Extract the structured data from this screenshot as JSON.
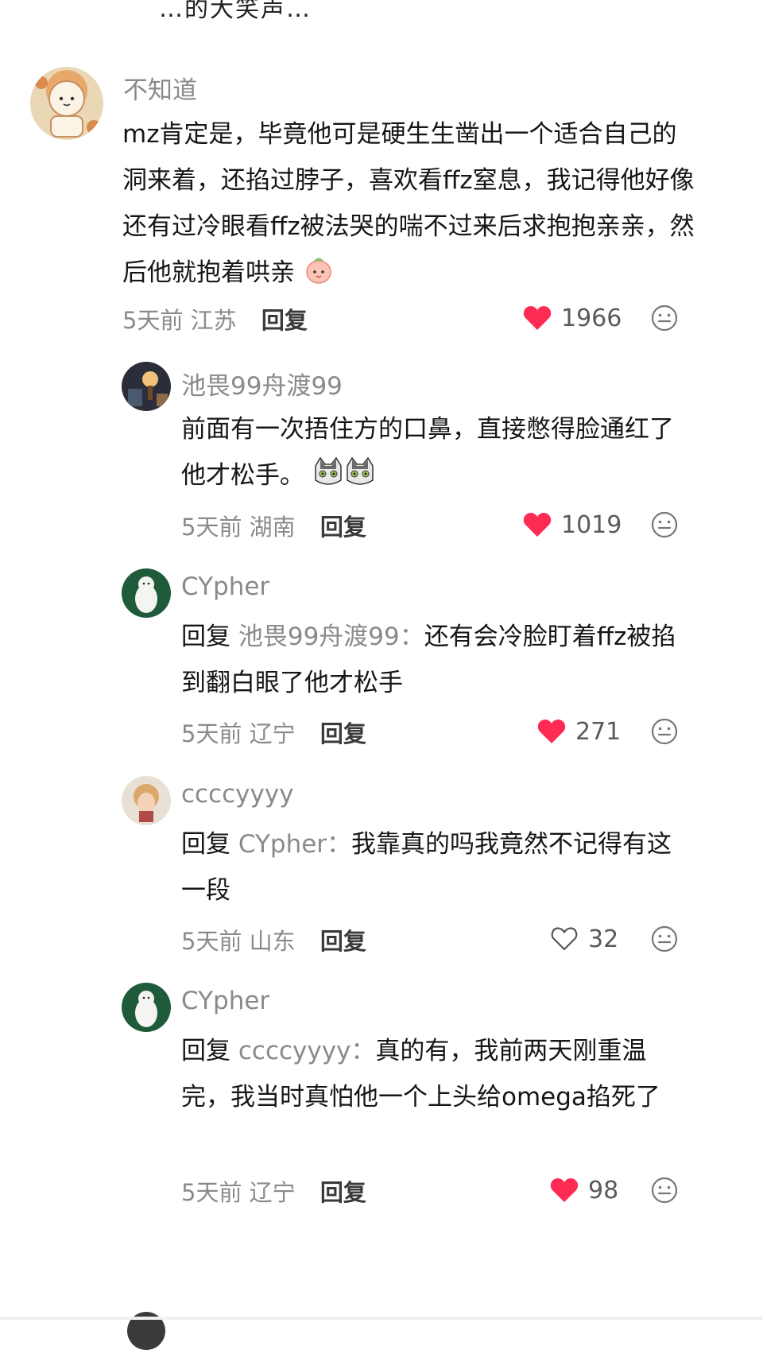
{
  "top_cut_text": "…的大笑声…",
  "comments": [
    {
      "username": "不知道",
      "text": "mz肯定是，毕竟他可是硬生生凿出一个适合自己的洞来着，还掐过脖子，喜欢看ffz窒息，我记得他好像还有过冷眼看ffz被法哭的喘不过来后求抱抱亲亲，然后他就抱着哄亲",
      "time": "5天前",
      "location": "江苏",
      "reply_label": "回复",
      "likes": "1966",
      "liked": true
    },
    {
      "username": "池畏99舟渡99",
      "text": "前面有一次捂住方的口鼻，直接憋得脸通红了他才松手。",
      "time": "5天前",
      "location": "湖南",
      "reply_label": "回复",
      "likes": "1019",
      "liked": true
    },
    {
      "username": "CYpher",
      "reply_prefix": "回复",
      "reply_target": "池畏99舟渡99：",
      "text": "还有会冷脸盯着ffz被掐到翻白眼了他才松手",
      "time": "5天前",
      "location": "辽宁",
      "reply_label": "回复",
      "likes": "271",
      "liked": true
    },
    {
      "username": "ccccyyyy",
      "reply_prefix": "回复",
      "reply_target": "CYpher：",
      "text": "我靠真的吗我竟然不记得有这一段",
      "time": "5天前",
      "location": "山东",
      "reply_label": "回复",
      "likes": "32",
      "liked": false
    },
    {
      "username": "CYpher",
      "reply_prefix": "回复",
      "reply_target": "ccccyyyy：",
      "text": "真的有，我前两天刚重温完，我当时真怕他一个上头给omega掐死了",
      "time": "5天前",
      "location": "辽宁",
      "reply_label": "回复",
      "likes": "98",
      "liked": true
    }
  ],
  "colors": {
    "like_red": "#fe2c55",
    "meta_gray": "#8a8a8a",
    "text_dark": "#161616"
  },
  "icons": {
    "like": "heart-icon",
    "emoji": "emoji-face-icon"
  }
}
